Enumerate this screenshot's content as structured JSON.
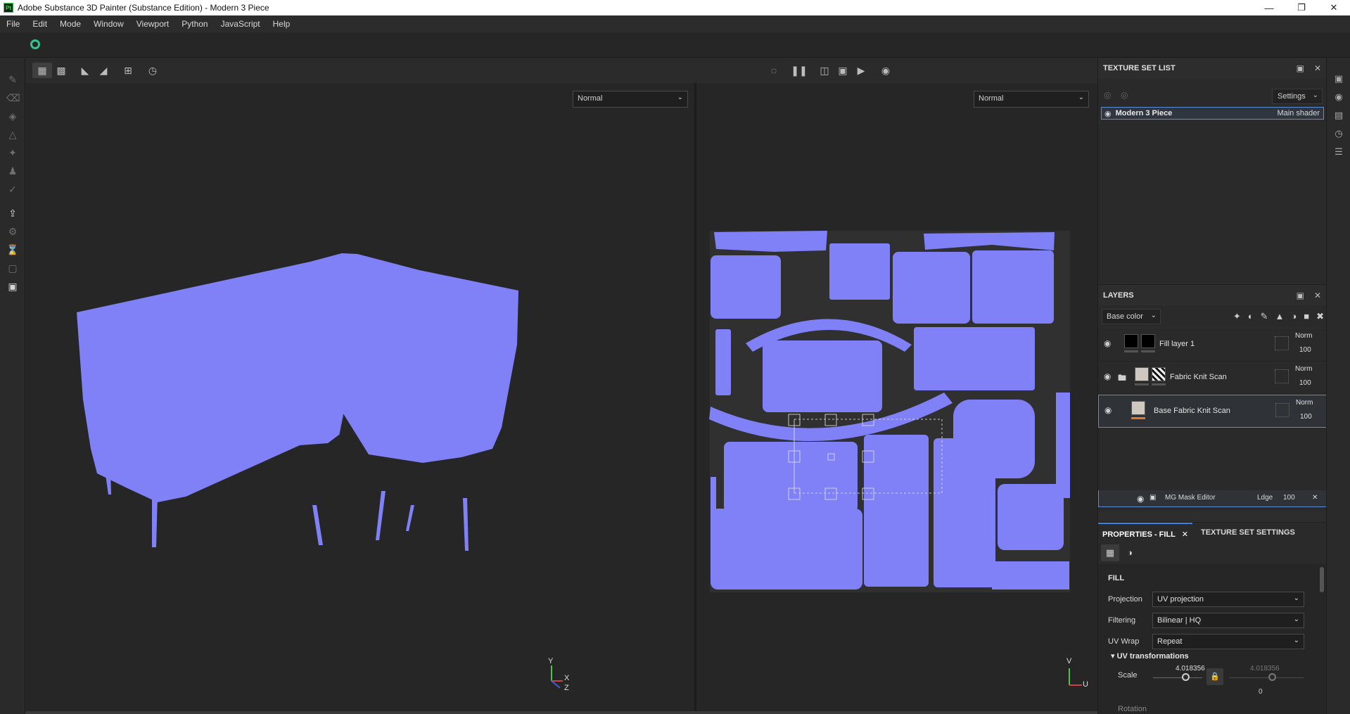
{
  "window": {
    "app_icon": "Pt",
    "title": "Adobe Substance 3D Painter (Substance Edition) - Modern 3 Piece",
    "controls": [
      "minimize",
      "restore",
      "close"
    ]
  },
  "menu": [
    "File",
    "Edit",
    "Mode",
    "Window",
    "Viewport",
    "Python",
    "JavaScript",
    "Help"
  ],
  "viewport3d": {
    "mode": "Normal",
    "axis_labels": {
      "y": "Y",
      "x": "X",
      "z": "Z"
    }
  },
  "viewport2d": {
    "mode": "Normal",
    "axis_labels": {
      "v": "V",
      "u": "U"
    }
  },
  "colors": {
    "mesh": "#8080f7",
    "uv_bg": "#303030",
    "accent": "#3c82e0",
    "selection": "#5a8fd6",
    "highlight_bar": "#e0792a"
  },
  "texture_set_list": {
    "title": "TEXTURE SET LIST",
    "settings_label": "Settings",
    "items": [
      {
        "name": "Modern 3 Piece",
        "shader": "Main shader"
      }
    ]
  },
  "layers": {
    "title": "LAYERS",
    "channel": "Base color",
    "items": [
      {
        "name": "Fill layer 1",
        "blend": "Norm",
        "opacity": "100"
      },
      {
        "name": "Fabric Knit Scan",
        "blend": "Norm",
        "opacity": "100"
      },
      {
        "name": "Base Fabric Knit Scan",
        "blend": "Norm",
        "opacity": "100"
      }
    ],
    "sub_item": {
      "name": "MG Mask Editor",
      "blend": "Ldge",
      "opacity": "100"
    }
  },
  "properties": {
    "tabs": [
      "PROPERTIES - FILL",
      "TEXTURE SET SETTINGS"
    ],
    "section": "FILL",
    "projection_label": "Projection",
    "projection": "UV projection",
    "filtering_label": "Filtering",
    "filtering": "Bilinear | HQ",
    "uvwrap_label": "UV Wrap",
    "uvwrap": "Repeat",
    "uv_transformations": "UV transformations",
    "scale_label": "Scale",
    "scale_u": "4.018356",
    "scale_v": "4.018356",
    "rotation_value": "0"
  }
}
